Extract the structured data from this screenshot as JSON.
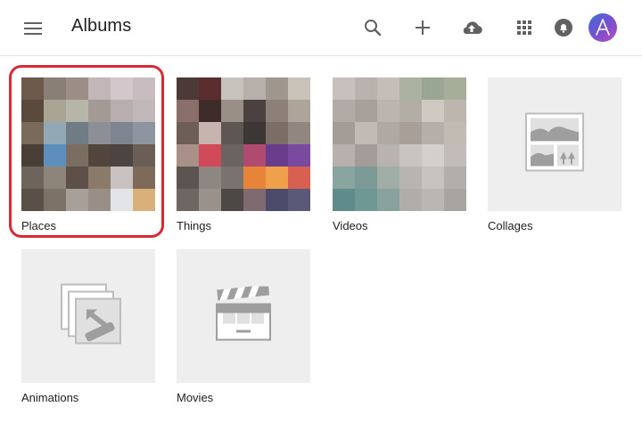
{
  "header": {
    "title": "Albums",
    "icons": [
      "menu-icon",
      "search-icon",
      "add-icon",
      "upload-cloud-icon",
      "apps-grid-icon",
      "notifications-icon",
      "account-avatar"
    ]
  },
  "albums": [
    {
      "label": "Places",
      "type": "photo-mosaic",
      "highlighted": true
    },
    {
      "label": "Things",
      "type": "photo-mosaic"
    },
    {
      "label": "Videos",
      "type": "photo-mosaic"
    },
    {
      "label": "Collages",
      "type": "placeholder",
      "icon": "collage-icon"
    },
    {
      "label": "Animations",
      "type": "placeholder",
      "icon": "animation-icon"
    },
    {
      "label": "Movies",
      "type": "placeholder",
      "icon": "movie-clapper-icon"
    }
  ],
  "colors": {
    "highlight": "#d82a35",
    "placeholder_bg": "#eeeeee",
    "icon_gray": "#757575",
    "avatar_gradient": [
      "#3d6fd8",
      "#c04ab8"
    ]
  }
}
